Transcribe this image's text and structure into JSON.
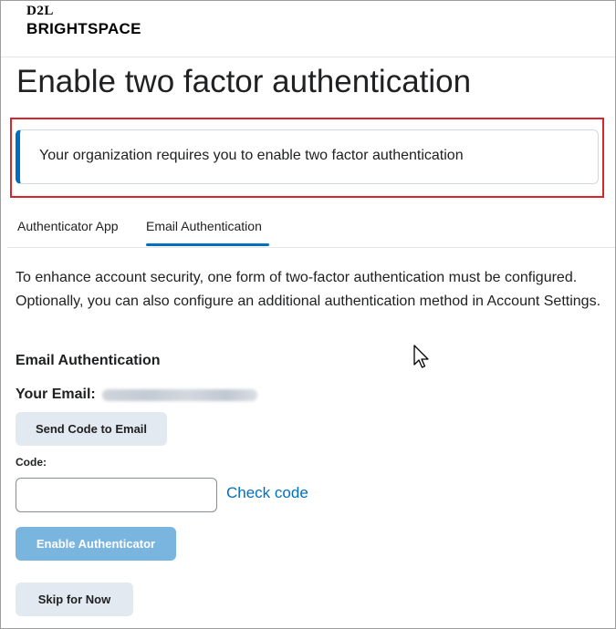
{
  "brand": {
    "top": "D2L",
    "bottom": "BRIGHTSPACE"
  },
  "page": {
    "title": "Enable two factor authentication"
  },
  "alert": {
    "message": "Your organization requires you to enable two factor authentication"
  },
  "tabs": [
    {
      "label": "Authenticator App",
      "selected": false
    },
    {
      "label": "Email Authentication",
      "selected": true
    }
  ],
  "intro": "To enhance account security, one form of two-factor authentication must be configured. Optionally, you can also configure an additional authentication method in Account Settings.",
  "email_section": {
    "title": "Email Authentication",
    "email_label": "Your Email:",
    "send_button": "Send Code to Email",
    "code_label": "Code:",
    "code_value": "",
    "check_link": "Check code",
    "enable_button": "Enable Authenticator",
    "skip_button": "Skip for Now"
  },
  "colors": {
    "accent": "#006fbf",
    "highlight_border": "#d9242b",
    "button_bg": "#e3e9f1",
    "disabled_primary": "#7ab5e0"
  },
  "icons": {
    "cursor": "mouse-pointer-icon"
  }
}
